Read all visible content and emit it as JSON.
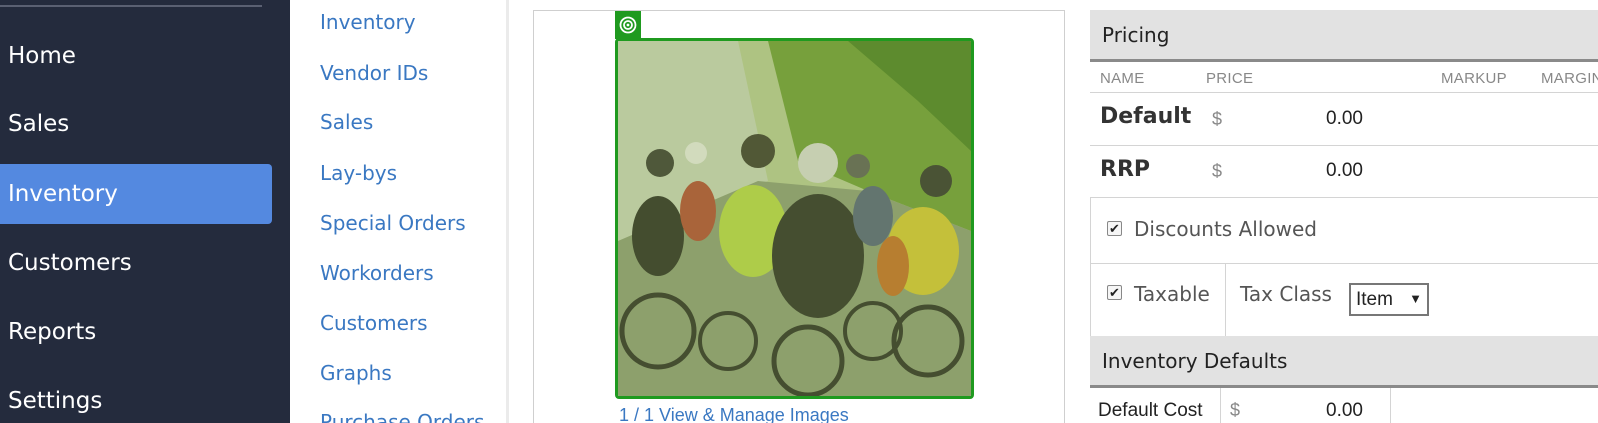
{
  "nav": {
    "items": [
      {
        "label": "Home",
        "active": false
      },
      {
        "label": "Sales",
        "active": false
      },
      {
        "label": "Inventory",
        "active": true
      },
      {
        "label": "Customers",
        "active": false
      },
      {
        "label": "Reports",
        "active": false
      },
      {
        "label": "Settings",
        "active": false
      }
    ],
    "colors": {
      "background": "#242b3d",
      "active": "#5489e0"
    }
  },
  "subnav": {
    "items": [
      "Inventory",
      "Vendor IDs",
      "Sales",
      "Lay-bys",
      "Special Orders",
      "Workorders",
      "Customers",
      "Graphs",
      "Purchase Orders"
    ],
    "link_color": "#3a78c2"
  },
  "image_panel": {
    "badge_icon": "target-icon",
    "photo_description_icon": "photo-cyclists",
    "links_text": "1 / 1     View & Manage Images",
    "highlight_color": "#1f9a1f"
  },
  "pricing": {
    "title": "Pricing",
    "columns": [
      "NAME",
      "PRICE",
      "MARKUP",
      "MARGIN"
    ],
    "rows": [
      {
        "name": "Default",
        "currency": "$",
        "value": "0.00"
      },
      {
        "name": "RRP",
        "currency": "$",
        "value": "0.00"
      }
    ],
    "discounts_label": "Discounts Allowed",
    "discounts_checked": true,
    "taxable_label": "Taxable",
    "taxable_checked": true,
    "tax_class_label": "Tax Class",
    "tax_class_value": "Item"
  },
  "inventory_defaults": {
    "title": "Inventory Defaults",
    "default_cost_label": "Default Cost",
    "currency": "$",
    "default_cost_value": "0.00"
  }
}
